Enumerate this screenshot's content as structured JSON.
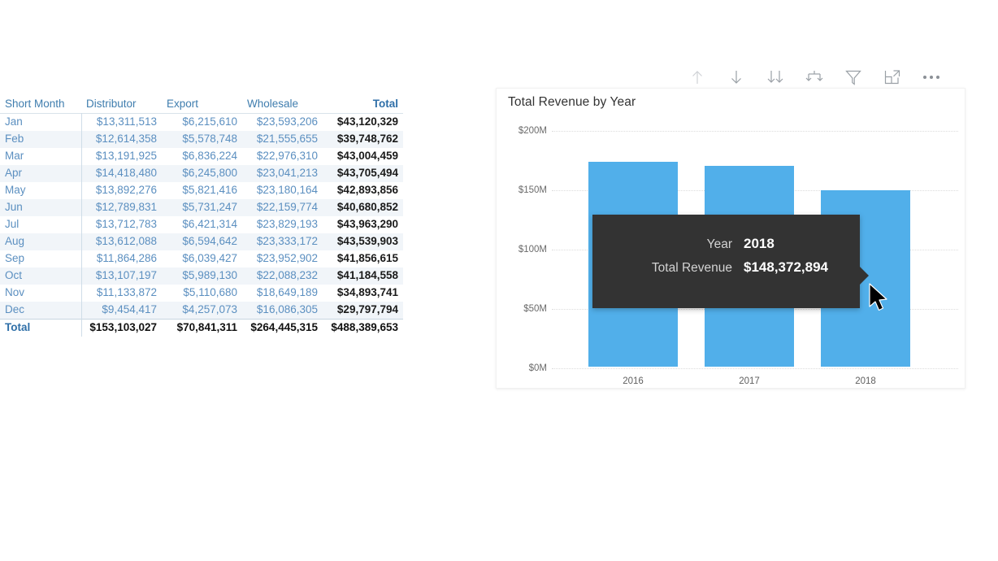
{
  "matrix": {
    "columns": [
      "Short Month",
      "Distributor",
      "Export",
      "Wholesale",
      "Total"
    ],
    "rows": [
      {
        "month": "Jan",
        "distributor": "$13,311,513",
        "export": "$6,215,610",
        "wholesale": "$23,593,206",
        "total": "$43,120,329"
      },
      {
        "month": "Feb",
        "distributor": "$12,614,358",
        "export": "$5,578,748",
        "wholesale": "$21,555,655",
        "total": "$39,748,762"
      },
      {
        "month": "Mar",
        "distributor": "$13,191,925",
        "export": "$6,836,224",
        "wholesale": "$22,976,310",
        "total": "$43,004,459"
      },
      {
        "month": "Apr",
        "distributor": "$14,418,480",
        "export": "$6,245,800",
        "wholesale": "$23,041,213",
        "total": "$43,705,494"
      },
      {
        "month": "May",
        "distributor": "$13,892,276",
        "export": "$5,821,416",
        "wholesale": "$23,180,164",
        "total": "$42,893,856"
      },
      {
        "month": "Jun",
        "distributor": "$12,789,831",
        "export": "$5,731,247",
        "wholesale": "$22,159,774",
        "total": "$40,680,852"
      },
      {
        "month": "Jul",
        "distributor": "$13,712,783",
        "export": "$6,421,314",
        "wholesale": "$23,829,193",
        "total": "$43,963,290"
      },
      {
        "month": "Aug",
        "distributor": "$13,612,088",
        "export": "$6,594,642",
        "wholesale": "$23,333,172",
        "total": "$43,539,903"
      },
      {
        "month": "Sep",
        "distributor": "$11,864,286",
        "export": "$6,039,427",
        "wholesale": "$23,952,902",
        "total": "$41,856,615"
      },
      {
        "month": "Oct",
        "distributor": "$13,107,197",
        "export": "$5,989,130",
        "wholesale": "$22,088,232",
        "total": "$41,184,558"
      },
      {
        "month": "Nov",
        "distributor": "$11,133,872",
        "export": "$5,110,680",
        "wholesale": "$18,649,189",
        "total": "$34,893,741"
      },
      {
        "month": "Dec",
        "distributor": "$9,454,417",
        "export": "$4,257,073",
        "wholesale": "$16,086,305",
        "total": "$29,797,794"
      }
    ],
    "grand_total": {
      "month": "Total",
      "distributor": "$153,103,027",
      "export": "$70,841,311",
      "wholesale": "$264,445,315",
      "total": "$488,389,653"
    }
  },
  "toolbar": {
    "items": [
      {
        "name": "drill-up-icon",
        "label": "Drill up",
        "enabled": false
      },
      {
        "name": "drill-down-toggle-icon",
        "label": "Click to turn on Drill down",
        "enabled": true
      },
      {
        "name": "go-to-next-level-icon",
        "label": "Go to the next level in the hierarchy",
        "enabled": true
      },
      {
        "name": "expand-all-down-icon",
        "label": "Expand all down one level in the hierarchy",
        "enabled": true
      },
      {
        "name": "filter-icon",
        "label": "Filters",
        "enabled": true
      },
      {
        "name": "focus-mode-icon",
        "label": "Focus mode",
        "enabled": true
      },
      {
        "name": "more-options-icon",
        "label": "More options",
        "enabled": true
      }
    ]
  },
  "chart_data": {
    "type": "bar",
    "title": "Total Revenue by Year",
    "xlabel": "",
    "ylabel": "",
    "categories": [
      "2016",
      "2017",
      "2018"
    ],
    "values": [
      172600000,
      169400000,
      148372894
    ],
    "value_labels": [
      "$172.6M",
      "$169.4M",
      "$148,372,894"
    ],
    "ylim": [
      0,
      200000000
    ],
    "yticks": [
      0,
      50000000,
      100000000,
      150000000,
      200000000
    ],
    "ytick_labels": [
      "$0M",
      "$50M",
      "$100M",
      "$150M",
      "$200M"
    ],
    "grid": true,
    "legend": "none",
    "series_color": "#51afea"
  },
  "tooltip": {
    "rows": [
      {
        "key": "Year",
        "value": "2018"
      },
      {
        "key": "Total Revenue",
        "value": "$148,372,894"
      }
    ]
  },
  "colors": {
    "bar": "#51afea",
    "tooltip_bg": "#333333",
    "header_text": "#3f7dae",
    "value_text": "#5b8fc0"
  }
}
